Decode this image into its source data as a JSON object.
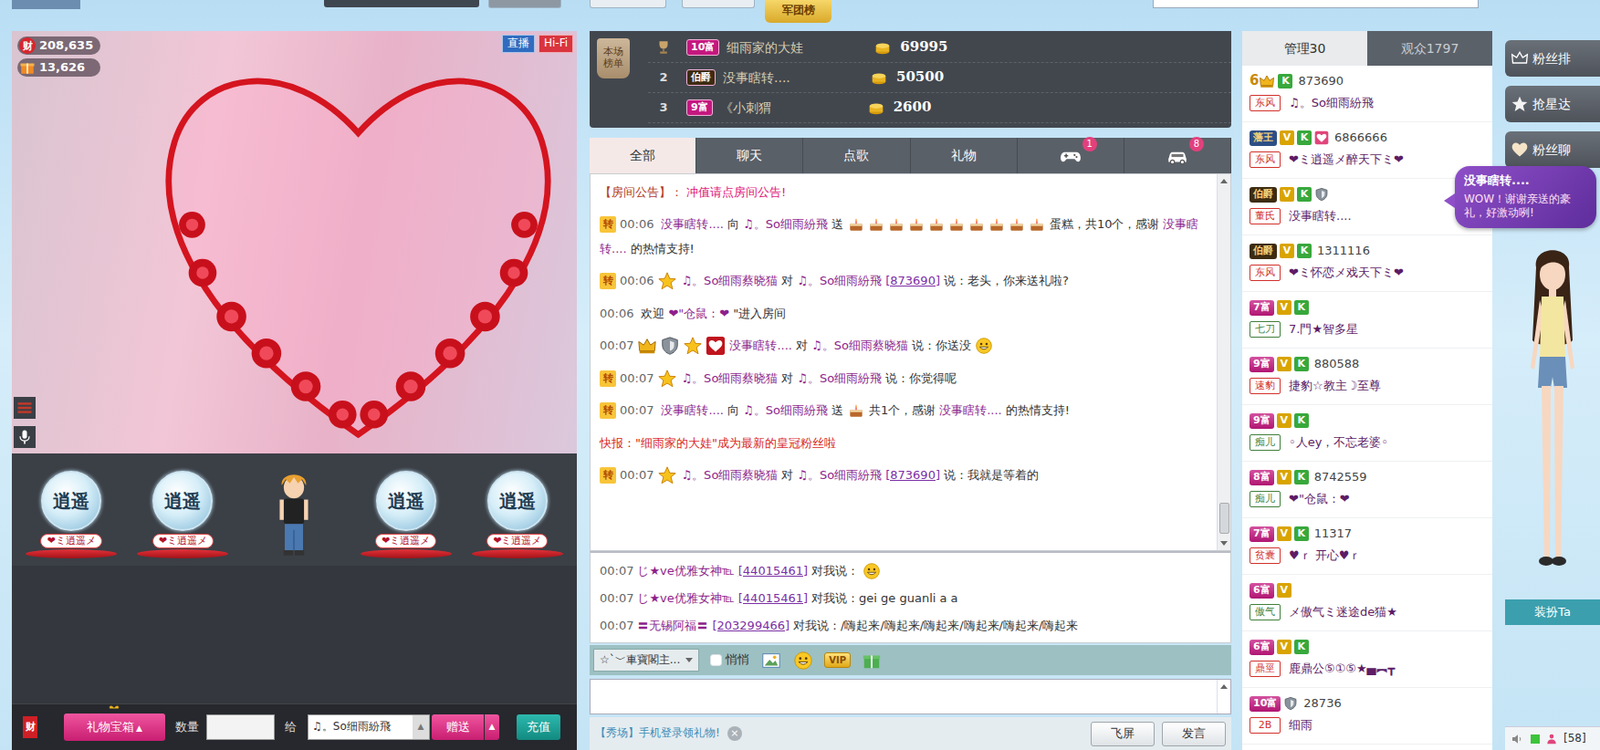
{
  "top_bar": {
    "board_tab": "军团榜"
  },
  "video": {
    "stats": [
      {
        "icon_text": "财",
        "value": "208,635"
      },
      {
        "value": "13,626"
      }
    ],
    "badges": [
      {
        "text": "直播",
        "color": "#2f6cc0"
      },
      {
        "text": "Hi-Fi",
        "color": "#d9343f"
      }
    ]
  },
  "seats": [
    {
      "kind": "globe",
      "emblem": "逍遥",
      "label": "❤ミ逍遥メ"
    },
    {
      "kind": "globe",
      "emblem": "逍遥",
      "label": "❤ミ逍遥メ"
    },
    {
      "kind": "avatar"
    },
    {
      "kind": "globe",
      "emblem": "逍遥",
      "label": "❤ミ逍遥メ"
    },
    {
      "kind": "globe",
      "emblem": "逍遥",
      "label": "❤ミ逍遥メ"
    }
  ],
  "gift_bar": {
    "wealth_icon": "财",
    "gift_box": "礼物宝箱",
    "gift_box_arrow": "▲",
    "quantity_label": "数量",
    "to_label": "给",
    "recipient": "♫。So细雨紛飛",
    "recipient_arrow": "▲",
    "send": "赠送",
    "send_arrow": "▲",
    "recharge": "充值"
  },
  "ranking": {
    "title": "本场榜单",
    "rows": [
      {
        "kind": "trophy",
        "badge": "10富",
        "badge_color": "#c4187f",
        "name": "细雨家的大娃",
        "amount": "69995"
      },
      {
        "kind": "number",
        "rank": "2",
        "badge": "伯爵",
        "badge_color": "#3d2c12",
        "name": "没事瞎转....",
        "amount": "50500"
      },
      {
        "kind": "number",
        "rank": "3",
        "badge": "9富",
        "badge_color": "#c4187f",
        "name": "《小刺猬",
        "amount": "2600"
      }
    ]
  },
  "chat": {
    "tabs": [
      {
        "kind": "text",
        "label": "全部",
        "selected": true
      },
      {
        "kind": "text",
        "label": "聊天",
        "selected": false
      },
      {
        "kind": "text",
        "label": "点歌",
        "selected": false
      },
      {
        "kind": "text",
        "label": "礼物",
        "selected": false
      },
      {
        "kind": "games",
        "count": "1",
        "selected": false
      },
      {
        "kind": "cars",
        "count": "8",
        "selected": false
      }
    ],
    "messages": [
      {
        "kind": "notice",
        "parts": [
          {
            "kind": "label",
            "text": "【房间公告】："
          },
          {
            "kind": "alert",
            "text": "冲值请点房间公告!"
          }
        ]
      },
      {
        "kind": "chat",
        "tag": "转",
        "time": "00:06",
        "medals": 0,
        "parts": [
          {
            "kind": "name",
            "text": "没事瞎转...."
          },
          {
            "kind": "text",
            "text": "向"
          },
          {
            "kind": "name",
            "text": "♫。So细雨紛飛"
          },
          {
            "kind": "text",
            "text": "送"
          },
          {
            "kind": "gifts",
            "count": 10
          },
          {
            "kind": "text",
            "text": "蛋糕，共10个，感谢"
          },
          {
            "kind": "name",
            "text": "没事瞎转...."
          },
          {
            "kind": "text",
            "text": "的热情支持!"
          }
        ]
      },
      {
        "kind": "chat",
        "tag": "转",
        "time": "00:06",
        "medals": 1,
        "parts": [
          {
            "kind": "name",
            "text": "♫。So细雨蔡晓猫"
          },
          {
            "kind": "text",
            "text": "对"
          },
          {
            "kind": "name",
            "text": "♫。So细雨紛飛"
          },
          {
            "kind": "id",
            "text": "[873690]"
          },
          {
            "kind": "text",
            "text": "说：老头，你来送礼啦?"
          }
        ]
      },
      {
        "kind": "chat",
        "time": "00:06",
        "medals": 0,
        "parts": [
          {
            "kind": "text",
            "text": "欢迎"
          },
          {
            "kind": "name",
            "text": "❤\"仓鼠：❤"
          },
          {
            "kind": "text",
            "text": "\"进入房间"
          }
        ]
      },
      {
        "kind": "chat",
        "time": "00:07",
        "medals": 4,
        "parts": [
          {
            "kind": "name",
            "text": "没事瞎转...."
          },
          {
            "kind": "text",
            "text": "对"
          },
          {
            "kind": "name",
            "text": "♫。So细雨蔡晓猫"
          },
          {
            "kind": "text",
            "text": "说：你送没"
          },
          {
            "kind": "smiley"
          }
        ]
      },
      {
        "kind": "chat",
        "tag": "转",
        "time": "00:07",
        "medals": 1,
        "parts": [
          {
            "kind": "name",
            "text": "♫。So细雨蔡晓猫"
          },
          {
            "kind": "text",
            "text": "对"
          },
          {
            "kind": "name",
            "text": "♫。So细雨紛飛"
          },
          {
            "kind": "text",
            "text": "说：你觉得呢"
          }
        ]
      },
      {
        "kind": "chat",
        "tag": "转",
        "time": "00:07",
        "medals": 0,
        "parts": [
          {
            "kind": "name",
            "text": "没事瞎转...."
          },
          {
            "kind": "text",
            "text": "向"
          },
          {
            "kind": "name",
            "text": "♫。So细雨紛飛"
          },
          {
            "kind": "text",
            "text": "送"
          },
          {
            "kind": "gifts",
            "count": 1
          },
          {
            "kind": "text",
            "text": "共1个，感谢"
          },
          {
            "kind": "name",
            "text": "没事瞎转...."
          },
          {
            "kind": "text",
            "text": "的热情支持!"
          }
        ]
      },
      {
        "kind": "news",
        "parts": [
          {
            "kind": "alert",
            "text": "快报：\"细雨家的大娃\"成为最新的皇冠粉丝啦"
          }
        ]
      },
      {
        "kind": "chat",
        "tag": "转",
        "time": "00:07",
        "medals": 1,
        "parts": [
          {
            "kind": "name",
            "text": "♫。So细雨蔡晓猫"
          },
          {
            "kind": "text",
            "text": "对"
          },
          {
            "kind": "name",
            "text": "♫。So细雨紛飛"
          },
          {
            "kind": "id",
            "text": "[873690]"
          },
          {
            "kind": "text",
            "text": "说：我就是等着的"
          }
        ]
      }
    ],
    "private": [
      {
        "time": "00:07",
        "parts": [
          {
            "kind": "name",
            "text": "じ★ve优雅女神℡"
          },
          {
            "kind": "id",
            "text": "[44015461]"
          },
          {
            "kind": "text",
            "text": "对我说："
          },
          {
            "kind": "smiley"
          }
        ]
      },
      {
        "time": "00:07",
        "parts": [
          {
            "kind": "name",
            "text": "じ★ve优雅女神℡"
          },
          {
            "kind": "id",
            "text": "[44015461]"
          },
          {
            "kind": "text",
            "text": "对我说：gei ge guanli a a"
          }
        ]
      },
      {
        "time": "00:07",
        "parts": [
          {
            "kind": "name",
            "text": "〓无锡阿福〓"
          },
          {
            "kind": "id",
            "text": "[203299466]"
          },
          {
            "kind": "text",
            "text": "对我说：/嗨起来/嗨起来/嗨起来/嗨起来/嗨起来/嗨起来"
          }
        ]
      }
    ]
  },
  "composer": {
    "target": "☆`﹀車寶閣主...",
    "whisper_label": "悄悄",
    "whisper": false,
    "vip_label": "VIP"
  },
  "footer": {
    "promo": "【秀场】手机登录领礼物!",
    "close": "×",
    "fly_screen": "飞屏",
    "send": "发言"
  },
  "users": {
    "tabs": [
      {
        "label": "管理30",
        "selected": true
      },
      {
        "label": "观众1797",
        "selected": false
      }
    ],
    "rows": [
      {
        "level": "6",
        "level_kind": "crown",
        "level_color": "#c98a00",
        "marks": [
          {
            "text": "K",
            "color": "#38a83c"
          }
        ],
        "guardian": false,
        "vip_star": false,
        "uid": "873690",
        "group": "东风",
        "group_color": "#d2302a",
        "name": "♫。So细雨紛飛"
      },
      {
        "level": "藩王",
        "level_kind": "title",
        "level_color": "#2d4f86",
        "marks": [
          {
            "text": "V",
            "color": "#d9a400"
          },
          {
            "text": "K",
            "color": "#38a83c"
          }
        ],
        "guardian": false,
        "vip_star": true,
        "uid": "6866666",
        "group": "东风",
        "group_color": "#d2302a",
        "name": "❤ミ逍遥メ醉天下ミ❤"
      },
      {
        "level": "伯爵",
        "level_kind": "title",
        "level_color": "#3d2c12",
        "marks": [
          {
            "text": "V",
            "color": "#d9a400"
          },
          {
            "text": "K",
            "color": "#38a83c"
          }
        ],
        "guardian": true,
        "vip_star": false,
        "group": "董氏",
        "group_color": "#d2302a",
        "name": "没事瞎转...."
      },
      {
        "level": "伯爵",
        "level_kind": "title",
        "level_color": "#3d2c12",
        "marks": [
          {
            "text": "V",
            "color": "#d9a400"
          },
          {
            "text": "K",
            "color": "#38a83c"
          }
        ],
        "guardian": false,
        "vip_star": false,
        "uid": "1311116",
        "group": "东风",
        "group_color": "#d2302a",
        "name": "❤ミ怀恋メ戏天下ミ❤"
      },
      {
        "level": "7富",
        "level_kind": "wealth",
        "level_color": "#c4187f",
        "marks": [
          {
            "text": "V",
            "color": "#d9a400"
          },
          {
            "text": "K",
            "color": "#38a83c"
          }
        ],
        "guardian": false,
        "vip_star": false,
        "group": "七刀",
        "group_color": "#3f7f3a",
        "name": "7.門★智多星"
      },
      {
        "level": "9富",
        "level_kind": "wealth",
        "level_color": "#c4187f",
        "marks": [
          {
            "text": "V",
            "color": "#d9a400"
          },
          {
            "text": "K",
            "color": "#38a83c"
          }
        ],
        "guardian": false,
        "vip_star": false,
        "uid": "880588",
        "group": "速豹",
        "group_color": "#d2302a",
        "name": "捷豹☆教主☽至尊"
      },
      {
        "level": "9富",
        "level_kind": "wealth",
        "level_color": "#c4187f",
        "marks": [
          {
            "text": "V",
            "color": "#d9a400"
          },
          {
            "text": "K",
            "color": "#38a83c"
          }
        ],
        "guardian": false,
        "vip_star": false,
        "group": "痴儿",
        "group_color": "#3f7f3a",
        "name": "◦人ey，不忘老婆◦"
      },
      {
        "level": "8富",
        "level_kind": "wealth",
        "level_color": "#c4187f",
        "marks": [
          {
            "text": "V",
            "color": "#d9a400"
          },
          {
            "text": "K",
            "color": "#38a83c"
          }
        ],
        "guardian": false,
        "vip_star": false,
        "uid": "8742559",
        "group": "痴儿",
        "group_color": "#3f7f3a",
        "name": "❤\"仓鼠：❤"
      },
      {
        "level": "7富",
        "level_kind": "wealth",
        "level_color": "#c4187f",
        "marks": [
          {
            "text": "V",
            "color": "#d9a400"
          },
          {
            "text": "K",
            "color": "#38a83c"
          }
        ],
        "guardian": false,
        "vip_star": false,
        "uid": "11317",
        "group": "贫囊",
        "group_color": "#d2302a",
        "name": "♥ｒ 开心♥ｒ"
      },
      {
        "level": "6富",
        "level_kind": "wealth",
        "level_color": "#c4187f",
        "marks": [
          {
            "text": "V",
            "color": "#d9a400"
          }
        ],
        "guardian": false,
        "vip_star": false,
        "group": "傲气",
        "group_color": "#3f7f3a",
        "name": "メ傲气ミ迷途de猫★"
      },
      {
        "level": "6富",
        "level_kind": "wealth",
        "level_color": "#c4187f",
        "marks": [
          {
            "text": "V",
            "color": "#d9a400"
          },
          {
            "text": "K",
            "color": "#38a83c"
          }
        ],
        "guardian": false,
        "vip_star": false,
        "group": "鼎巠",
        "group_color": "#d2302a",
        "name": "鹿鼎公⑤①⑤★▄︻┳"
      },
      {
        "level": "10富",
        "level_kind": "wealth",
        "level_color": "#c4187f",
        "marks": [],
        "guardian": true,
        "vip_star": false,
        "uid": "28736",
        "group": "2B",
        "group_color": "#d2302a",
        "name": "细雨"
      }
    ]
  },
  "bubble": {
    "title": "没事瞎转....",
    "text": "WOW！谢谢亲送的豪礼，好激动咧!"
  },
  "side_buttons": [
    {
      "label": "粉丝排"
    },
    {
      "label": "抢星达"
    },
    {
      "label": "粉丝聊"
    }
  ],
  "dress_up": "装扮Ta",
  "status": {
    "count": "[58]",
    "online": true
  }
}
